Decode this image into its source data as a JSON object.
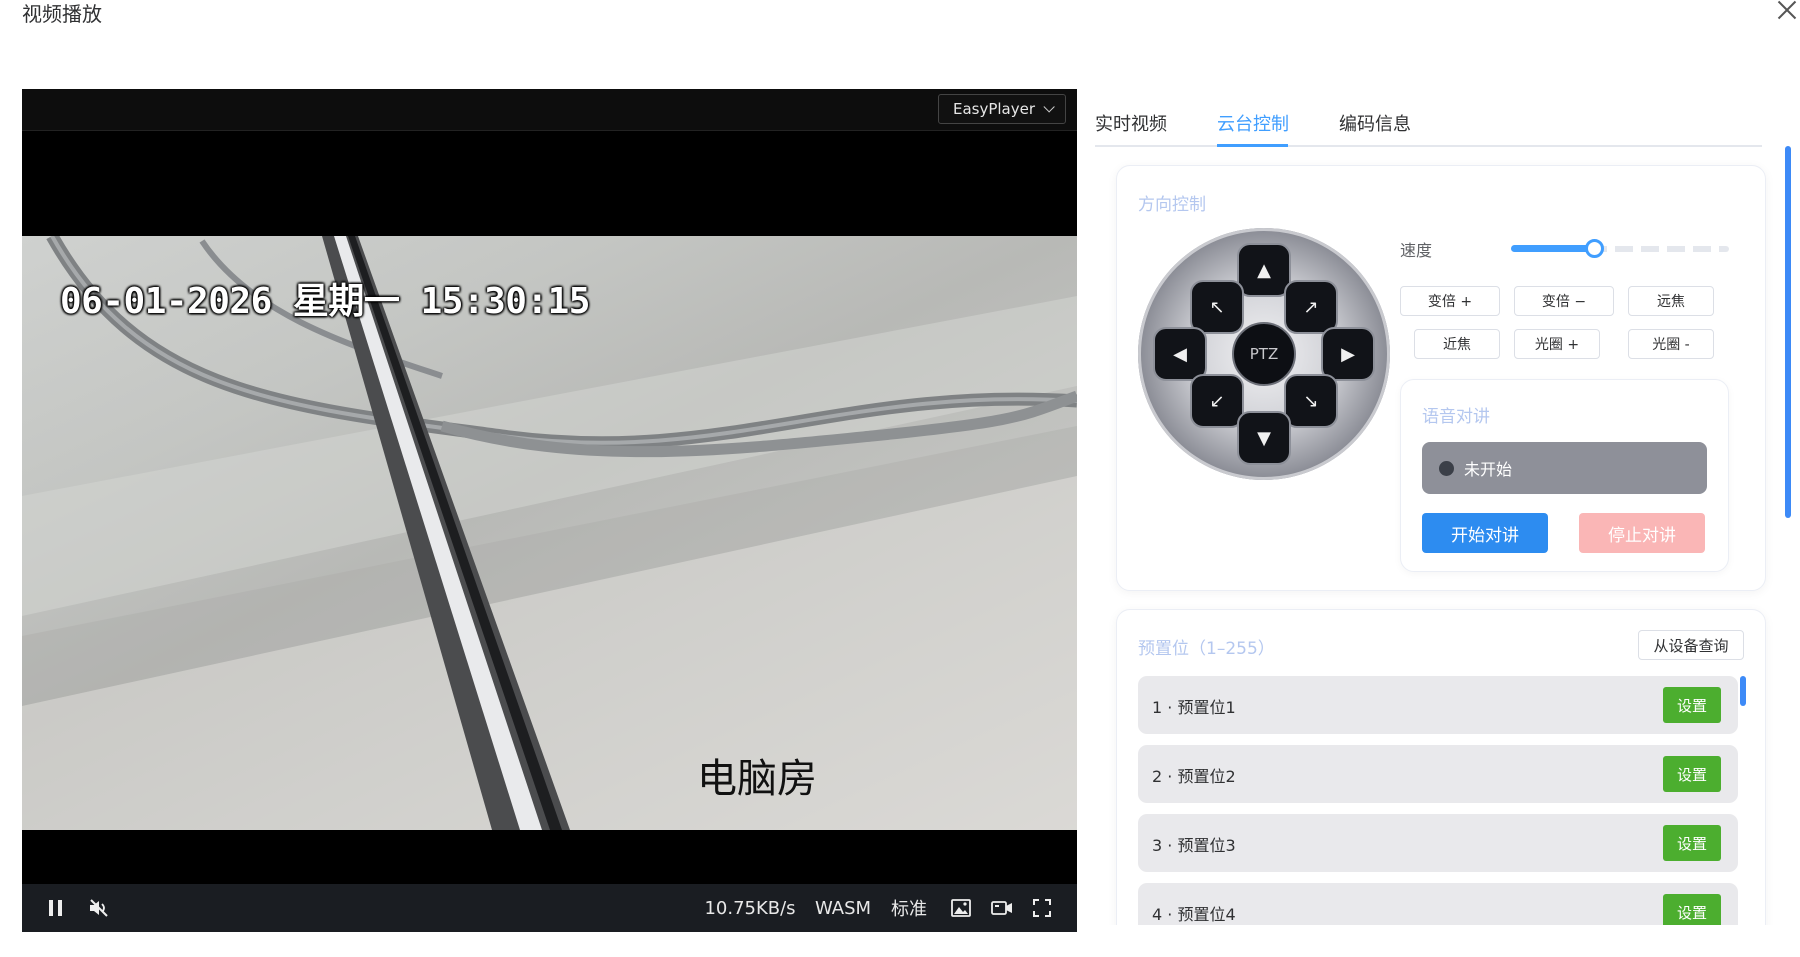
{
  "dialog": {
    "title": "视频播放"
  },
  "player": {
    "engine": "EasyPlayer",
    "osd_time": "06-01-2026 星期一 15:30:15",
    "osd_name": "电脑房",
    "bitrate": "10.75KB/s",
    "decoder": "WASM",
    "quality": "标准"
  },
  "tabs": [
    {
      "label": "实时视频"
    },
    {
      "label": "云台控制",
      "active": true
    },
    {
      "label": "编码信息"
    }
  ],
  "direction": {
    "title": "方向控制",
    "center_label": "PTZ",
    "speed_label": "速度",
    "speed_fraction": 0.38,
    "op_buttons": [
      "变倍 +",
      "变倍 −",
      "远焦",
      "近焦",
      "光圈 +",
      "光圈 -"
    ]
  },
  "talk": {
    "title": "语音对讲",
    "status": "未开始",
    "start_label": "开始对讲",
    "stop_label": "停止对讲"
  },
  "presets": {
    "title": "预置位（1–255）",
    "query_label": "从设备查询",
    "set_label": "设置",
    "items": [
      {
        "name": "1 · 预置位1"
      },
      {
        "name": "2 · 预置位2"
      },
      {
        "name": "3 · 预置位3"
      },
      {
        "name": "4 · 预置位4"
      }
    ]
  },
  "colors": {
    "accent": "#409eff",
    "set_button": "#4cae2f",
    "stop_button": "#fab6b6",
    "status_bar": "#8e9099"
  },
  "icons": [
    "close-icon",
    "chevron-down-icon",
    "pause-icon",
    "mute-icon",
    "snapshot-icon",
    "record-icon",
    "fullscreen-icon",
    "arrow-up-icon",
    "arrow-down-icon",
    "arrow-left-icon",
    "arrow-right-icon",
    "arrow-up-left-icon",
    "arrow-up-right-icon",
    "arrow-down-left-icon",
    "arrow-down-right-icon"
  ]
}
